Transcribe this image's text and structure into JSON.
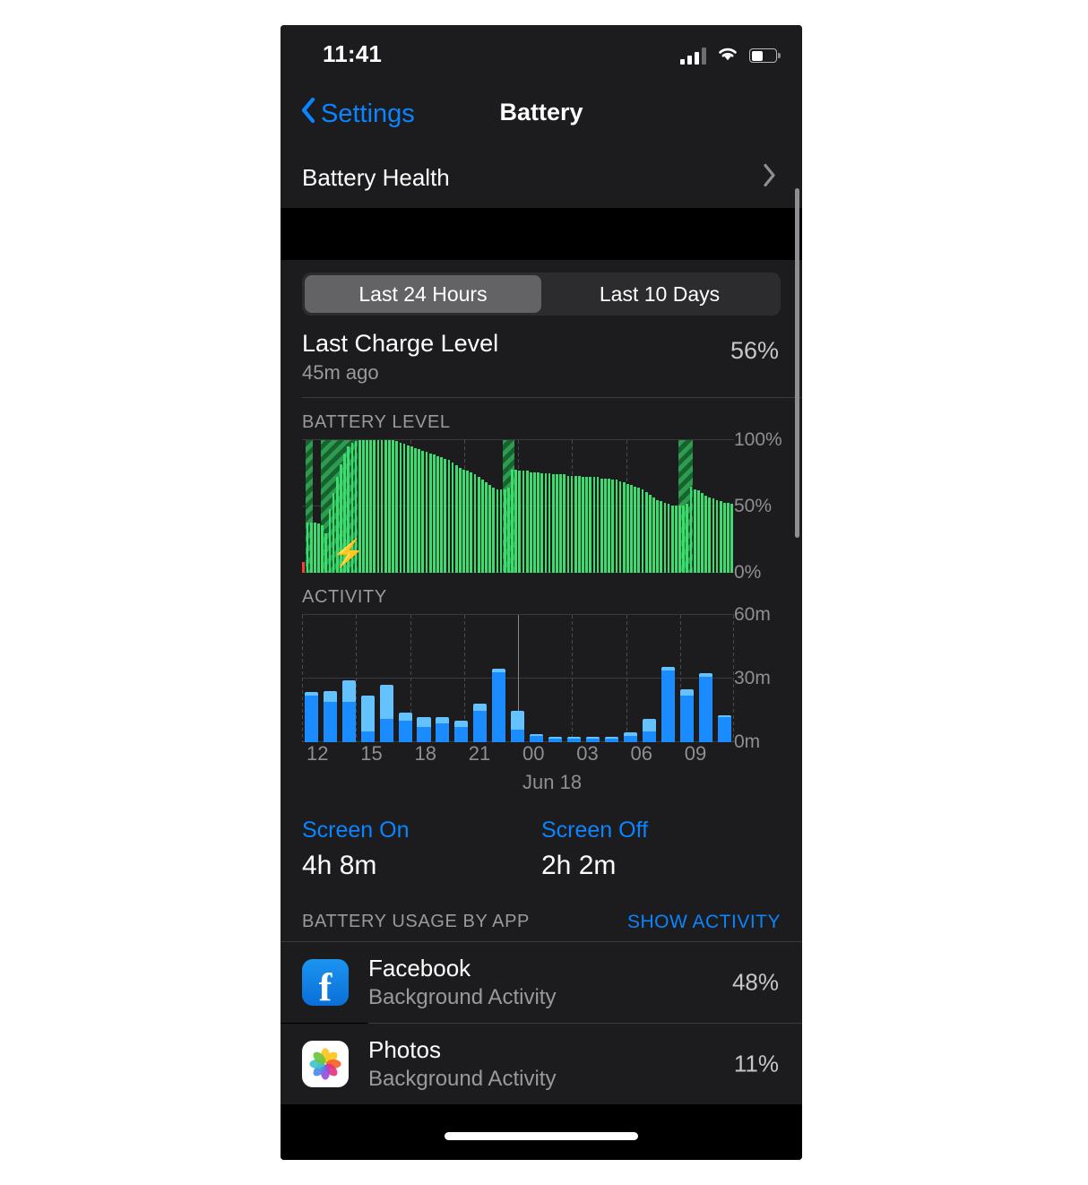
{
  "status_bar": {
    "time": "11:41",
    "signal_icon": "cellular-signal-icon",
    "wifi_icon": "wifi-icon",
    "battery_icon": "battery-icon"
  },
  "nav": {
    "back_label": "Settings",
    "back_icon": "chevron-left-icon",
    "title": "Battery"
  },
  "battery_health": {
    "label": "Battery Health",
    "chevron_icon": "chevron-right-icon"
  },
  "segmented": {
    "options": [
      "Last 24 Hours",
      "Last 10 Days"
    ],
    "selected": "Last 24 Hours"
  },
  "last_charge": {
    "title": "Last Charge Level",
    "subtitle": "45m ago",
    "value": "56%"
  },
  "sections": {
    "battery_level": "BATTERY LEVEL",
    "activity": "ACTIVITY",
    "usage_by_app": "BATTERY USAGE BY APP",
    "show_activity": "SHOW ACTIVITY"
  },
  "screen_time": {
    "on_label": "Screen On",
    "on_value": "4h 8m",
    "off_label": "Screen Off",
    "off_value": "2h 2m"
  },
  "apps": [
    {
      "name": "Facebook",
      "subtitle": "Background Activity",
      "percent": "48%",
      "icon": "facebook-icon"
    },
    {
      "name": "Photos",
      "subtitle": "Background Activity",
      "percent": "11%",
      "icon": "photos-icon"
    }
  ],
  "colors": {
    "accent_blue": "#0a84ff",
    "battery_green": "#3ddc6e",
    "battery_red": "#ff3b30",
    "activity_screen_on": "#1a8cff",
    "activity_screen_off": "#64c3ff",
    "card_bg": "#1c1c1e",
    "page_bg": "#000000"
  },
  "chart_data": [
    {
      "type": "bar",
      "title": "BATTERY LEVEL",
      "ylabel": "",
      "ylim": [
        0,
        100
      ],
      "ytick_labels": [
        "0%",
        "50%",
        "100%"
      ],
      "yticks": [
        0,
        50,
        100
      ],
      "grid": true,
      "bar_color": "#3ddc6e",
      "low_color": "#ff3b30",
      "charging_band_label": "charging",
      "charging_icon": "lightning-bolt-icon",
      "values": [
        8,
        38,
        38,
        38,
        37,
        36,
        30,
        48,
        60,
        72,
        82,
        90,
        95,
        98,
        99,
        100,
        100,
        100,
        100,
        100,
        100,
        100,
        100,
        100,
        100,
        99,
        98,
        97,
        96,
        95,
        94,
        93,
        92,
        91,
        90,
        89,
        88,
        87,
        86,
        85,
        83,
        81,
        79,
        78,
        77,
        76,
        74,
        72,
        70,
        68,
        66,
        64,
        63,
        63,
        63,
        64,
        78,
        78,
        77,
        77,
        77,
        76,
        76,
        76,
        75,
        75,
        75,
        74,
        74,
        74,
        74,
        73,
        73,
        73,
        73,
        72,
        72,
        72,
        72,
        72,
        71,
        71,
        71,
        70,
        70,
        69,
        68,
        67,
        66,
        65,
        64,
        63,
        61,
        59,
        57,
        55,
        54,
        53,
        52,
        51,
        51,
        51,
        51,
        52,
        65,
        63,
        62,
        60,
        58,
        57,
        56,
        55,
        54,
        53,
        53,
        52
      ],
      "low_indices": [
        0
      ],
      "charging_spans": [
        [
          1,
          2
        ],
        [
          5,
          14
        ],
        [
          54,
          56
        ],
        [
          101,
          104
        ]
      ]
    },
    {
      "type": "bar",
      "title": "ACTIVITY",
      "ylabel": "",
      "ylim": [
        0,
        60
      ],
      "ytick_labels": [
        "0m",
        "30m",
        "60m"
      ],
      "yticks": [
        0,
        30,
        60
      ],
      "grid": true,
      "xlabel": "",
      "x_tick_labels": [
        "12",
        "15",
        "18",
        "21",
        "00",
        "03",
        "06",
        "09"
      ],
      "day_divider_label": "Jun 18",
      "day_divider_at": "00",
      "stacked": true,
      "series": [
        {
          "name": "Screen On",
          "color": "#1a8cff",
          "values": [
            22,
            19,
            19,
            5,
            11,
            10,
            7,
            9,
            7,
            15,
            33,
            6,
            3,
            1.5,
            1.5,
            1.5,
            1.5,
            3,
            5,
            34,
            22,
            31,
            12
          ]
        },
        {
          "name": "Screen Off",
          "color": "#64c3ff",
          "values": [
            1.5,
            5,
            10,
            17,
            16,
            4,
            5,
            3,
            3,
            3,
            1.5,
            9,
            0.8,
            0.8,
            0.8,
            0.8,
            0.8,
            1.5,
            6,
            1.5,
            3,
            1.5,
            0.8
          ]
        }
      ]
    }
  ]
}
